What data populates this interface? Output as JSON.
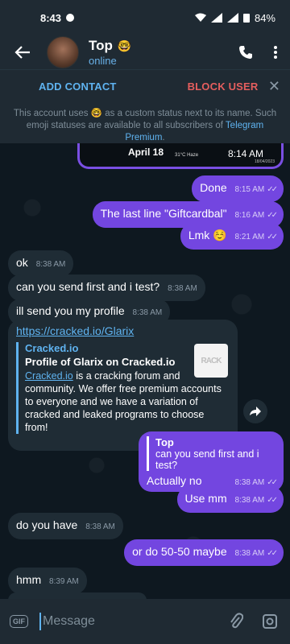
{
  "status_bar": {
    "time": "8:43",
    "battery": "84%"
  },
  "header": {
    "title": "Top",
    "emoji_status": "🤓",
    "subtitle": "online"
  },
  "action_bar": {
    "add_contact": "ADD CONTACT",
    "block_user": "BLOCK USER"
  },
  "notice": {
    "text_before": "This account uses ",
    "emoji": "🤓",
    "text_mid": " as a custom status next to its name. Such emoji statuses are available to all subscribers of ",
    "link": "Telegram Premium",
    "text_end": "."
  },
  "photo": {
    "date": "April 18",
    "weather": "31°C Haze",
    "clock": "8:14 AM",
    "date_small": "18/04/2023"
  },
  "messages": [
    {
      "side": "out",
      "text": "Done",
      "time": "8:15 AM"
    },
    {
      "side": "out",
      "text": "The last line \"Giftcardbal\"",
      "time": "8:16 AM"
    },
    {
      "side": "out",
      "text": "Lmk ☺️",
      "time": "8:21 AM"
    },
    {
      "side": "in",
      "text": "ok",
      "time": "8:38 AM"
    },
    {
      "side": "in",
      "text": "can you send first and i test?",
      "time": "8:38 AM"
    },
    {
      "side": "in",
      "text": "ill send you my profile",
      "time": "8:38 AM"
    }
  ],
  "link_message": {
    "url": "https://cracked.io/Glarix",
    "site": "Cracked.io",
    "title": "Profile of Glarix on Cracked.io",
    "desc_link": "Cracked.io",
    "desc": " is a cracking forum and community. We offer free premium accounts to everyone and we have a variation of cracked and leaked programs to choose from!",
    "thumb": "RACK",
    "time": "8:38 AM"
  },
  "reply_message": {
    "quote_name": "Top",
    "quote_text": "can you send first and i test?",
    "text": "Actually no",
    "time": "8:38 AM"
  },
  "messages2": [
    {
      "side": "out",
      "text": "Use mm",
      "time": "8:38 AM"
    },
    {
      "side": "in",
      "text": "do you have",
      "time": "8:38 AM"
    },
    {
      "side": "out",
      "text": "or do 50-50 maybe",
      "time": "8:38 AM"
    },
    {
      "side": "in",
      "text": "hmm",
      "time": "8:39 AM"
    }
  ],
  "input": {
    "placeholder": "Message",
    "gif_label": "GIF"
  },
  "colors": {
    "outgoing": "#7346e0",
    "incoming": "#1f2c35",
    "accent": "#5fb3f0",
    "danger": "#e55e5e"
  }
}
